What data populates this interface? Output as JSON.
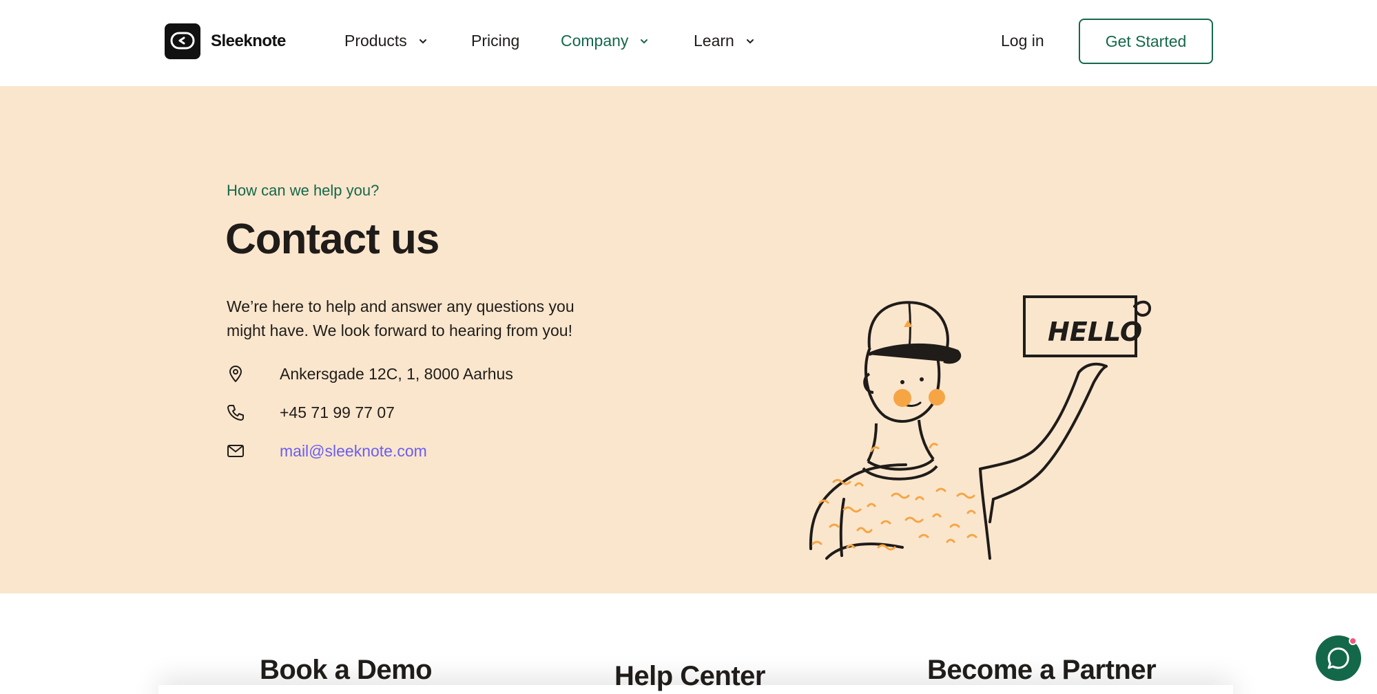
{
  "brand": {
    "name": "Sleeknote"
  },
  "nav": {
    "items": [
      {
        "label": "Products",
        "has_dropdown": true
      },
      {
        "label": "Pricing",
        "has_dropdown": false
      },
      {
        "label": "Company",
        "has_dropdown": true,
        "active": true
      },
      {
        "label": "Learn",
        "has_dropdown": true
      }
    ],
    "login_label": "Log in",
    "cta_label": "Get Started"
  },
  "hero": {
    "eyebrow": "How can we help you?",
    "title": "Contact us",
    "description": "We’re here to help and answer any questions you might have. We look forward to hearing from you!",
    "contacts": [
      {
        "icon": "location-pin-icon",
        "text": "Ankersgade 12C, 1, 8000 Aarhus"
      },
      {
        "icon": "phone-icon",
        "text": "+45 71 99 77 07"
      },
      {
        "icon": "mail-icon",
        "text": "mail@sleeknote.com"
      }
    ],
    "illustration": {
      "sign_text": "HELLO"
    }
  },
  "cards": [
    {
      "title": "Book a Demo"
    },
    {
      "title": "Help Center"
    },
    {
      "title": "Become a Partner"
    }
  ],
  "colors": {
    "accent": "#14684a",
    "hero_bg": "#fae6cd",
    "link": "#6a5ef0",
    "text": "#1f1c19",
    "illustration_accent": "#f6a545"
  }
}
